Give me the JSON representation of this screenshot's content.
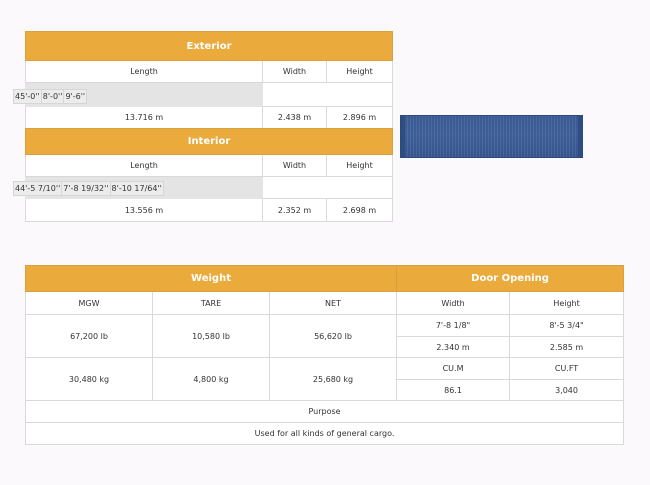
{
  "exterior": {
    "title": "Exterior",
    "headers": [
      "Length",
      "Width",
      "Height"
    ],
    "imperial": [
      "45'-0''",
      "8'-0''",
      "9'-6''"
    ],
    "metric": [
      "13.716 m",
      "2.438 m",
      "2.896 m"
    ]
  },
  "interior": {
    "title": "Interior",
    "headers": [
      "Length",
      "Width",
      "Height"
    ],
    "imperial": [
      "44'-5 7/10''",
      "7'-8 19/32''",
      "8'-10 17/64''"
    ],
    "metric": [
      "13.556 m",
      "2.352 m",
      "2.698 m"
    ]
  },
  "photo": {
    "icon": "shipping-container-image",
    "color": "#3d5f9a"
  },
  "weight": {
    "title": "Weight",
    "headers": [
      "MGW",
      "TARE",
      "NET"
    ],
    "lb": [
      "67,200 lb",
      "10,580 lb",
      "56,620 lb"
    ],
    "kg": [
      "30,480 kg",
      "4,800 kg",
      "25,680 kg"
    ]
  },
  "door": {
    "title": "Door Opening",
    "headers": [
      "Width",
      "Height"
    ],
    "imperial": [
      "7'-8 1/8\"",
      "8'-5 3/4\""
    ],
    "metric": [
      "2.340 m",
      "2.585 m"
    ],
    "capacity_headers": [
      "CU.M",
      "CU.FT"
    ],
    "capacity": [
      "86.1",
      "3,040"
    ]
  },
  "purpose": {
    "label": "Purpose",
    "text": "Used for all kinds of general cargo."
  },
  "colors": {
    "header_bg": "#eaaa3c",
    "border": "#d9d9d9"
  }
}
